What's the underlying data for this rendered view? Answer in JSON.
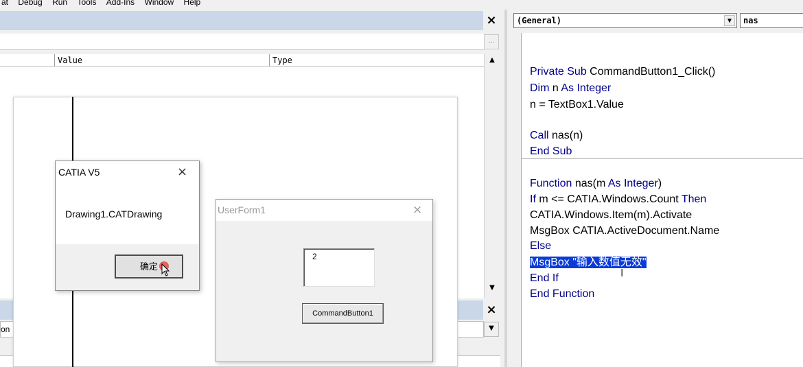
{
  "menubar": {
    "items": [
      "at",
      "Debug",
      "Run",
      "Tools",
      "Add-Ins",
      "Window",
      "Help"
    ]
  },
  "locals": {
    "context_button": "...",
    "columns": [
      "Value",
      "Type"
    ]
  },
  "watch": {
    "combo_text": "on"
  },
  "code_window": {
    "object_combo": "(General)",
    "proc_combo": "nas",
    "lines": [
      "Private Sub CommandButton1_Click()",
      "Dim n As Integer",
      "n = TextBox1.Value",
      "Call nas(n)",
      "End Sub",
      "Function nas(m As Integer)",
      "If m <= CATIA.Windows.Count Then",
      "CATIA.Windows.Item(m).Activate",
      "MsgBox CATIA.ActiveDocument.Name",
      "Else",
      "MsgBox \"输入数值无效\"",
      "End If",
      "End Function"
    ],
    "text_cursor": "I"
  },
  "msgbox": {
    "title": "CATIA V5",
    "message": "Drawing1.CATDrawing",
    "ok_label": "确定"
  },
  "userform": {
    "title": "UserForm1",
    "textbox_value": "2",
    "button_label": "CommandButton1"
  },
  "icons": {
    "close": "×",
    "dropdown": "▼",
    "scroll_up": "▲",
    "scroll_down": "▼"
  }
}
